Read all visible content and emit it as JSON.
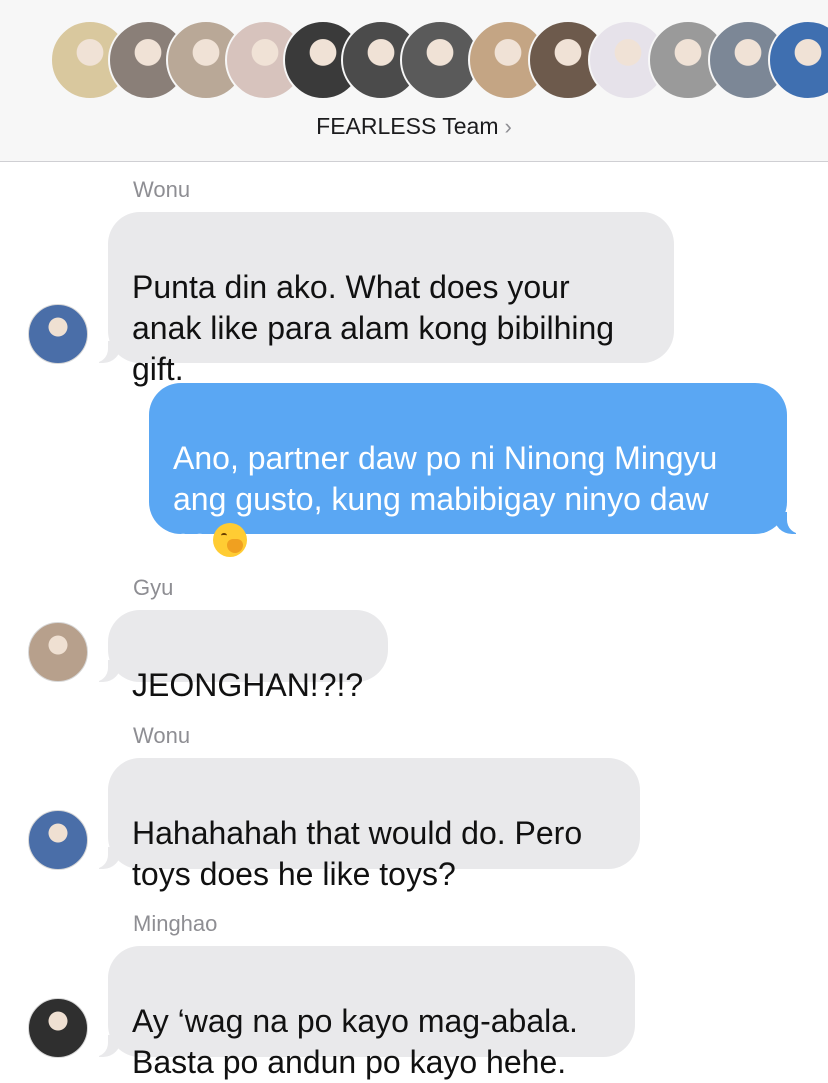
{
  "header": {
    "group_name": "FEARLESS Team",
    "chevron": "›",
    "avatars": [
      {
        "name": "member-1",
        "color": "#d9c89e"
      },
      {
        "name": "member-2",
        "color": "#8a7f78"
      },
      {
        "name": "member-3",
        "color": "#b9a897"
      },
      {
        "name": "member-4",
        "color": "#d7c3bd"
      },
      {
        "name": "member-5",
        "color": "#3a3a3a"
      },
      {
        "name": "member-6",
        "color": "#4b4b4b"
      },
      {
        "name": "member-7",
        "color": "#5a5a5a"
      },
      {
        "name": "member-8",
        "color": "#c4a584"
      },
      {
        "name": "member-9",
        "color": "#6d5a4c"
      },
      {
        "name": "member-10",
        "color": "#e6e2ea"
      },
      {
        "name": "member-11",
        "color": "#9a9a9a"
      },
      {
        "name": "member-12",
        "color": "#7c8796"
      },
      {
        "name": "member-13",
        "color": "#3f6fb0"
      }
    ]
  },
  "messages": [
    {
      "sender": "Wonu",
      "direction": "in",
      "text": "Punta din ako. What does your\nanak like para alam kong bibilhing\ngift.",
      "avatar_color": "#4a6ea8"
    },
    {
      "sender": "",
      "direction": "out",
      "text": "Ano, partner daw po ni Ninong Mingyu\nang gusto, kung mabibigay ninyo daw\npo",
      "emoji": "face-with-hand-over-mouth-emoji"
    },
    {
      "sender": "Gyu",
      "direction": "in",
      "text": "JEONGHAN!?!?",
      "avatar_color": "#b7a08c"
    },
    {
      "sender": "Wonu",
      "direction": "in",
      "text": "Hahahahah that would do. Pero\ntoys does he like toys?",
      "avatar_color": "#4a6ea8"
    },
    {
      "sender": "Minghao",
      "direction": "in",
      "text": "Ay ‘wag na po kayo mag-abala.\nBasta po andun po kayo hehe.",
      "avatar_color": "#2f2f2f"
    }
  ]
}
